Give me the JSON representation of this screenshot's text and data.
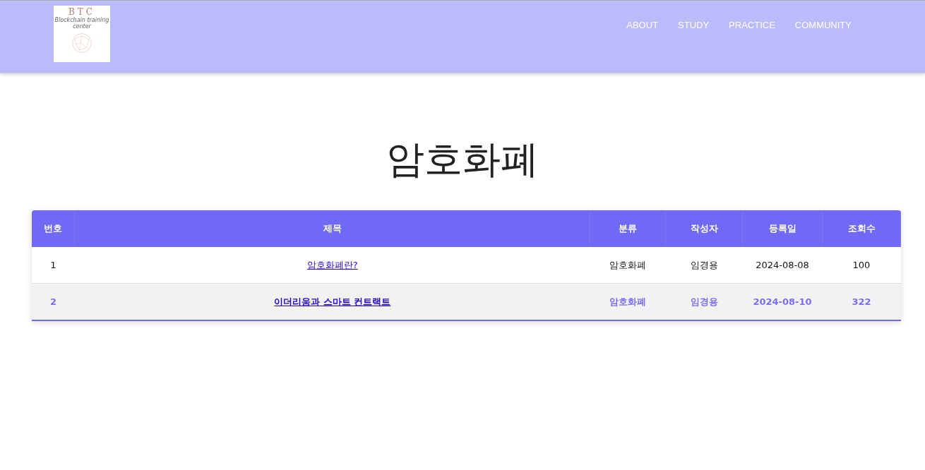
{
  "logo": {
    "title": "BTC",
    "subtitle": "Blockchain training center"
  },
  "nav": [
    "ABOUT",
    "STUDY",
    "PRACTICE",
    "COMMUNITY"
  ],
  "page_title": "암호화폐",
  "table": {
    "columns": [
      "번호",
      "제목",
      "분류",
      "작성자",
      "등록일",
      "조회수"
    ],
    "rows": [
      {
        "number": "1",
        "title": "암호화폐란?",
        "category": "암호화폐",
        "author": "임경용",
        "date": "2024-08-08",
        "views": "100",
        "selected": false
      },
      {
        "number": "2",
        "title": "이더리움과 스마트 컨트랙트",
        "category": "암호화폐",
        "author": "임경용",
        "date": "2024-08-10",
        "views": "322",
        "selected": true
      }
    ]
  }
}
